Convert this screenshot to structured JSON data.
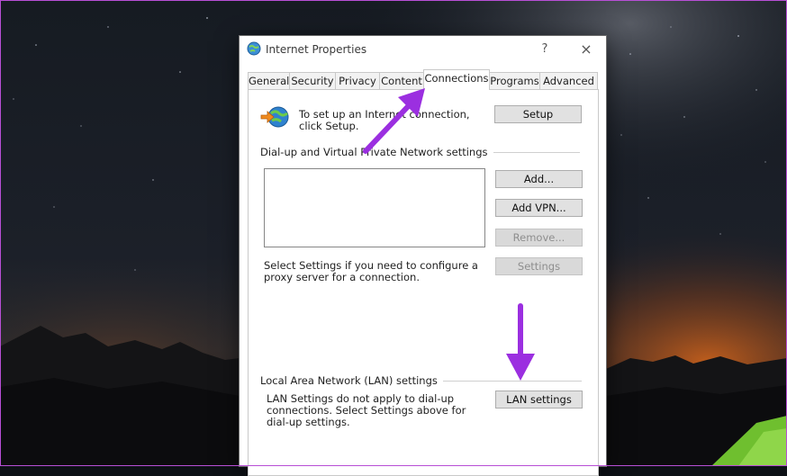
{
  "dialog": {
    "title": "Internet Properties",
    "help_label": "?",
    "close_label": "×"
  },
  "tabs": [
    {
      "label": "General"
    },
    {
      "label": "Security"
    },
    {
      "label": "Privacy"
    },
    {
      "label": "Content"
    },
    {
      "label": "Connections",
      "active": true
    },
    {
      "label": "Programs"
    },
    {
      "label": "Advanced"
    }
  ],
  "connections": {
    "setup_text": "To set up an Internet connection, click Setup.",
    "setup_button": "Setup",
    "dialup_group_title": "Dial-up and Virtual Private Network settings",
    "add_button": "Add...",
    "add_vpn_button": "Add VPN...",
    "remove_button": "Remove...",
    "settings_button": "Settings",
    "proxy_text": "Select Settings if you need to configure a proxy server for a connection.",
    "lan_group_title": "Local Area Network (LAN) settings",
    "lan_text": "LAN Settings do not apply to dial-up connections. Select Settings above for dial-up settings.",
    "lan_settings_button": "LAN settings"
  },
  "colors": {
    "annotation_arrow": "#9b2fe0",
    "frame_border": "#b84fd6"
  },
  "icons": {
    "title_icon": "internet-globe-icon",
    "setup_icon": "globe-connect-icon"
  }
}
